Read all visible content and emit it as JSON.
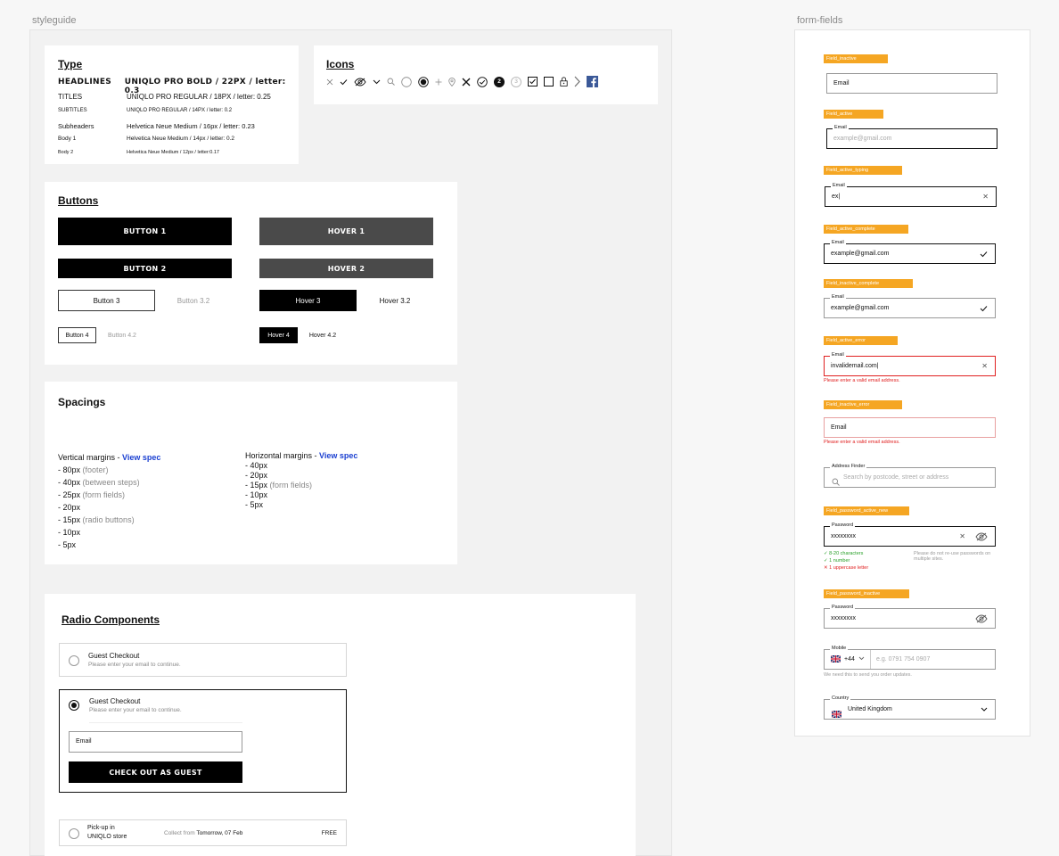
{
  "frames": {
    "styleguide_label": "styleguide",
    "formfields_label": "form-fields"
  },
  "type": {
    "heading": "Type",
    "rows": [
      {
        "label": "HEADLINES",
        "spec": "UNIQLO PRO BOLD / 22PX / letter: 0.3"
      },
      {
        "label": "TITLES",
        "spec": "UNIQLO PRO REGULAR / 18PX / letter: 0.25"
      },
      {
        "label": "SUBTITLES",
        "spec": "UNIQLO PRO REGULAR  /  14PX  /  letter: 0.2"
      },
      {
        "label": "Subheaders",
        "spec": "Helvetica Neue Medium / 16px / letter: 0.23"
      },
      {
        "label": "Body 1",
        "spec": "Helvetica Neue Medium / 14px / letter: 0.2"
      },
      {
        "label": "Body 2",
        "spec": "Helvetica Neue Medium / 12px / letter:0.17"
      }
    ]
  },
  "icons": {
    "heading": "Icons",
    "list": [
      "close-thin-icon",
      "check-icon",
      "eye-off-icon",
      "chevron-down-icon",
      "search-icon",
      "radio-off-icon",
      "radio-on-icon",
      "plus-icon",
      "pin-icon",
      "close-bold-icon",
      "check-circle-icon",
      "step-2-icon",
      "step-3-icon",
      "checkbox-checked-icon",
      "checkbox-empty-icon",
      "lock-icon",
      "chevron-right-icon",
      "facebook-icon"
    ],
    "step_active": "2",
    "step_inactive": "3"
  },
  "buttons": {
    "heading": "Buttons",
    "button1": "BUTTON 1",
    "hover1": "HOVER 1",
    "button2": "BUTTON 2",
    "hover2": "HOVER 2",
    "button3": "Button 3",
    "button32": "Button 3.2",
    "hover3": "Hover 3",
    "hover32": "Hover 3.2",
    "button4": "Button 4",
    "button42": "Button 4.2",
    "hover4": "Hover 4",
    "hover42": "Hover 4.2"
  },
  "spacings": {
    "heading": "Spacings",
    "vertical_title": "Vertical margins - ",
    "horizontal_title": "Horizontal margins - ",
    "view_spec": "View spec",
    "vertical": [
      {
        "value": "- 80px",
        "note": "(footer)"
      },
      {
        "value": "- 40px",
        "note": "(between steps)"
      },
      {
        "value": "- 25px",
        "note": "(form fields)"
      },
      {
        "value": "- 20px",
        "note": ""
      },
      {
        "value": "- 15px",
        "note": "(radio buttons)"
      },
      {
        "value": "- 10px",
        "note": ""
      },
      {
        "value": "- 5px",
        "note": ""
      }
    ],
    "horizontal": [
      {
        "value": "- 40px",
        "note": ""
      },
      {
        "value": "- 20px",
        "note": ""
      },
      {
        "value": "- 15px",
        "note": "(form fields)"
      },
      {
        "value": "- 10px",
        "note": ""
      },
      {
        "value": "- 5px",
        "note": ""
      }
    ]
  },
  "radio": {
    "heading": "Radio Components",
    "option_title": "Guest Checkout",
    "option_sub": "Please enter your email to continue.",
    "email_placeholder": "Email",
    "cta": "CHECK OUT AS GUEST",
    "pickup_line1": "Pick-up in",
    "pickup_line2": "UNIQLO store",
    "collect_prefix": "Collect from ",
    "collect_date": "Tomorrow, 07 Feb",
    "price": "FREE"
  },
  "fields": {
    "tags": {
      "inactive": "Field_inactive",
      "active": "Field_active",
      "active_typing": "Field_active_typing",
      "active_complete": "Field_active_complete",
      "inactive_complete": "Field_inactive_complete",
      "active_error": "Field_active_error",
      "inactive_error": "Field_inactive_error",
      "password_active_new": "Field_password_active_new",
      "password_inactive": "Field_password_inactive"
    },
    "email_label": "Email",
    "email_placeholder": "example@gmail.com",
    "typing_value": "ex|",
    "complete_value": "example@gmail.com",
    "error_value": "invalidemail.com|",
    "error_msg": "Please enter a valid email address.",
    "address_label": "Address Finder",
    "address_placeholder": "Search by postcode, street or address",
    "password_label": "Password",
    "password_value": "xxxxxxxx",
    "pw_rule1": "✓ 8-20 characters",
    "pw_rule2": "✓ 1 number",
    "pw_rule3": "✕ 1 uppercase letter",
    "pw_hint": "Please do not re-use passwords on multiple sites.",
    "mobile_label": "Mobile",
    "mobile_code": "+44",
    "mobile_placeholder": "e.g. 0791 754 0907",
    "mobile_hint": "We need this to send you order updates.",
    "country_label": "Country",
    "country_value": "United Kingdom"
  },
  "colors": {
    "tag": "#f5a623",
    "error": "#e02020",
    "success": "#2aa02a",
    "link": "#1a3fd1"
  }
}
